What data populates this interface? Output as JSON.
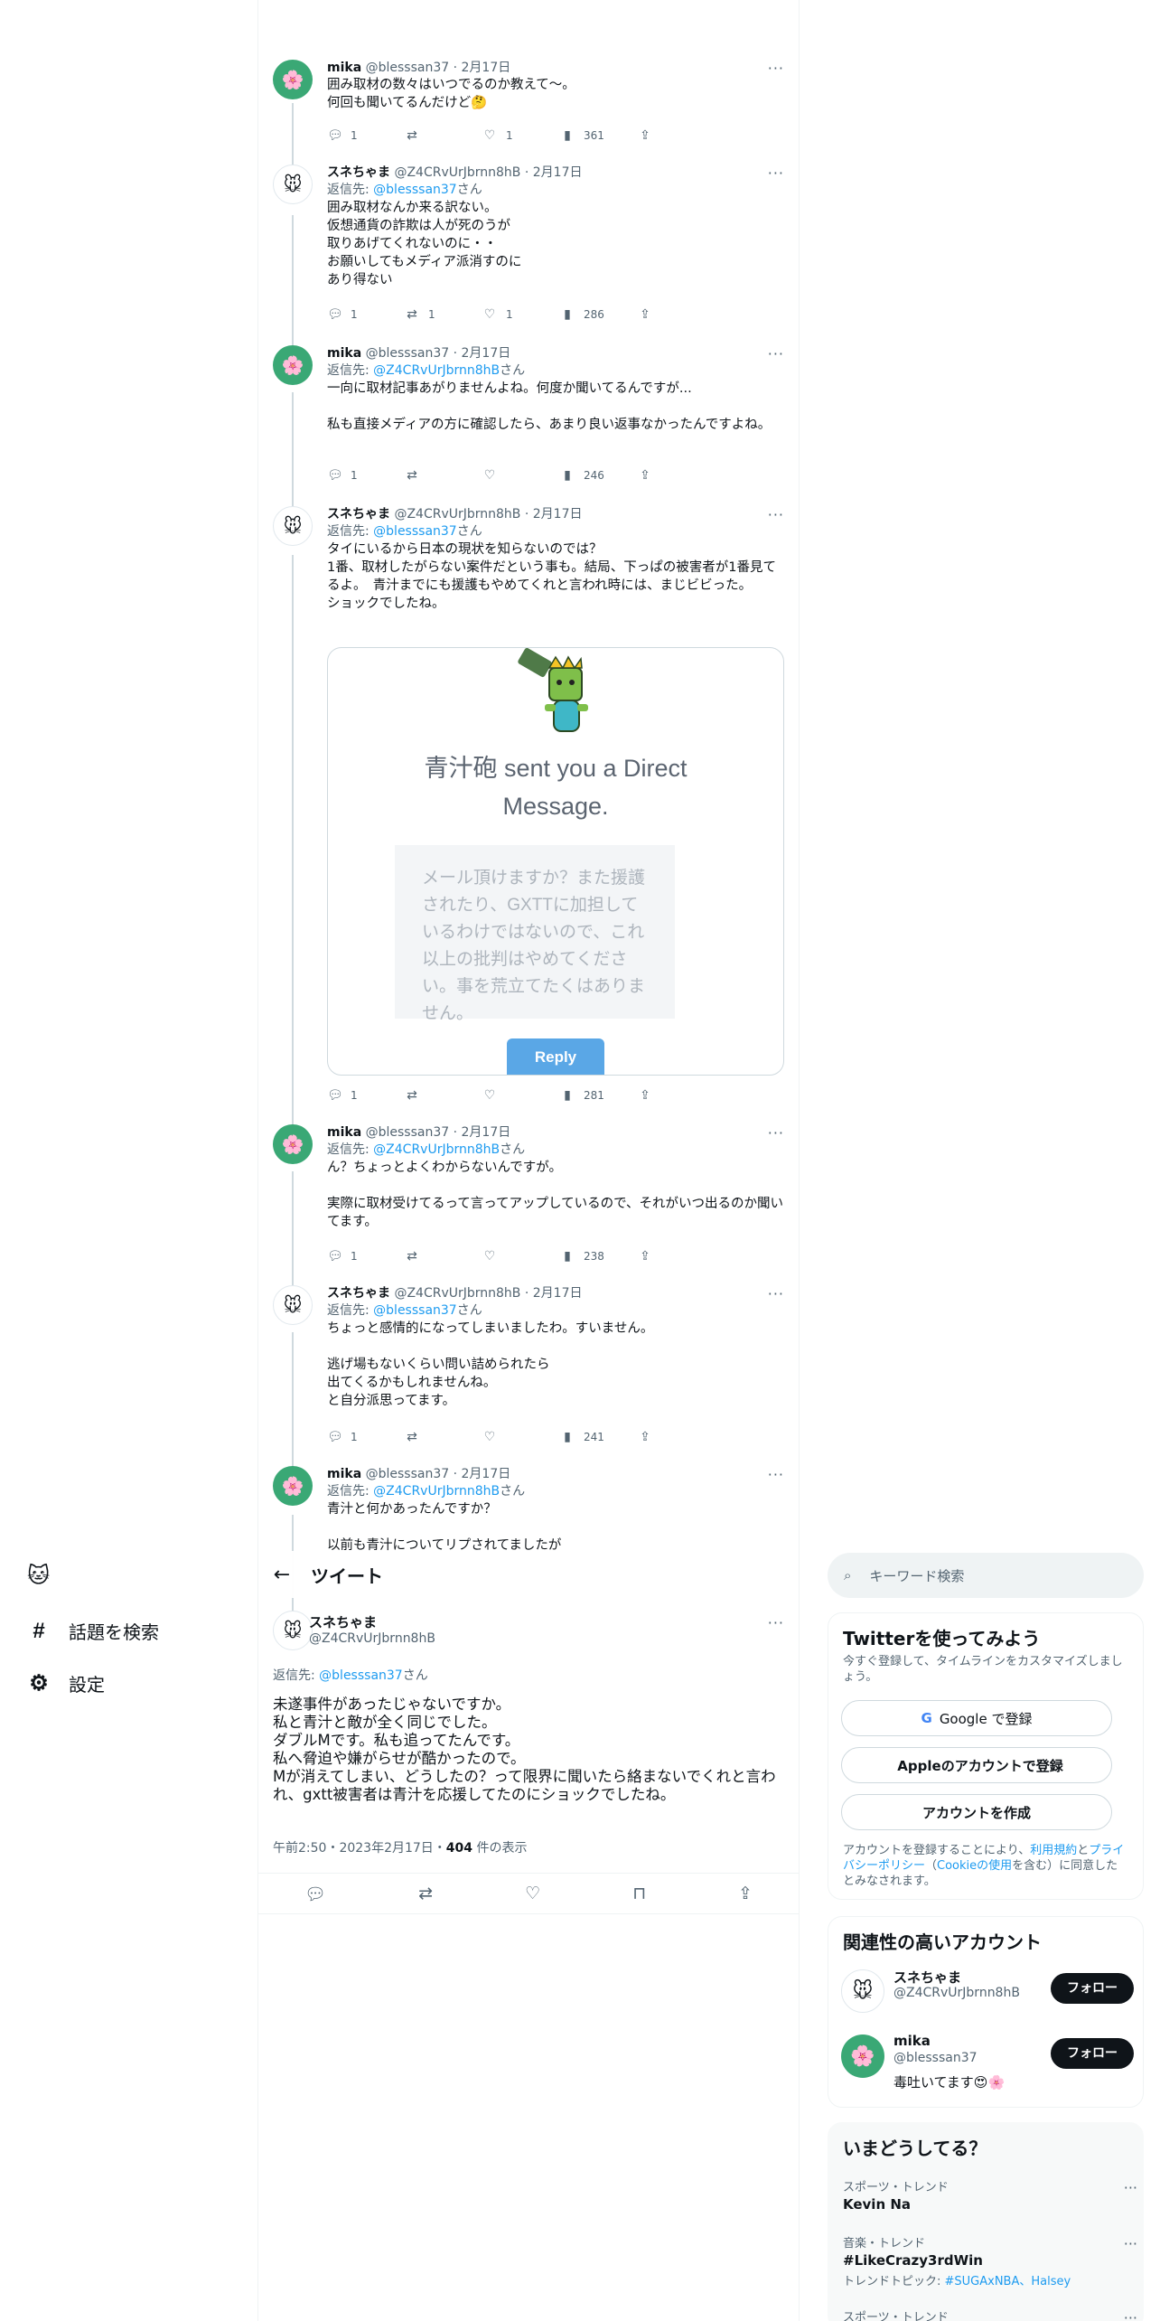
{
  "nav": {
    "logo_icon": "🐱",
    "items": [
      {
        "label": "話題を検索",
        "icon": "#"
      },
      {
        "label": "設定",
        "icon": "⚙"
      }
    ]
  },
  "tweets": [
    {
      "name": "mika",
      "handle": "@blesssan37",
      "date": "2月17日",
      "avatar": "mika",
      "reply_to": null,
      "text": "囲み取材の数々はいつでるのか教えて〜。\n何回も聞いてるんだけど🤔",
      "replies": "1",
      "retweets": "",
      "likes": "1",
      "views": "361"
    },
    {
      "name": "スネちゃま",
      "handle": "@Z4CRvUrJbrnn8hB",
      "date": "2月17日",
      "avatar": "sune",
      "reply_to": "@blesssan37",
      "text": "囲み取材なんか来る訳ない。\n仮想通貨の詐欺は人が死のうが\n取りあげてくれないのに・・\nお願いしてもメディア派消すのに\nあり得ない",
      "replies": "1",
      "retweets": "1",
      "likes": "1",
      "views": "286"
    },
    {
      "name": "mika",
      "handle": "@blesssan37",
      "date": "2月17日",
      "avatar": "mika",
      "reply_to": "@Z4CRvUrJbrnn8hB",
      "text": "一向に取材記事あがりませんよね。何度か聞いてるんですが...\n\n私も直接メディアの方に確認したら、あまり良い返事なかったんですよね。",
      "replies": "1",
      "retweets": "",
      "likes": "",
      "views": "246"
    },
    {
      "name": "スネちゃま",
      "handle": "@Z4CRvUrJbrnn8hB",
      "date": "2月17日",
      "avatar": "sune",
      "reply_to": "@blesssan37",
      "text": "タイにいるから日本の現状を知らないのでは？\n1番、取材したがらない案件だという事も。結局、下っぱの被害者が1番見てるよ。　青汁までにも援護もやめてくれと言われ時には、まじビビった。\nショックでしたね。",
      "replies": "1",
      "retweets": "",
      "likes": "",
      "views": "281"
    },
    {
      "name": "mika",
      "handle": "@blesssan37",
      "date": "2月17日",
      "avatar": "mika",
      "reply_to": "@Z4CRvUrJbrnn8hB",
      "text": "ん？ちょっとよくわからないんですが。\n\n実際に取材受けてるって言ってアップしているので、それがいつ出るのか聞いてます。",
      "replies": "1",
      "retweets": "",
      "likes": "",
      "views": "238"
    },
    {
      "name": "スネちゃま",
      "handle": "@Z4CRvUrJbrnn8hB",
      "date": "2月17日",
      "avatar": "sune",
      "reply_to": "@blesssan37",
      "text": "ちょっと感情的になってしまいましたわ。すいません。\n\n逃げ場もないくらい問い詰められたら\n出てくるかもしれませんね。\nと自分派思ってます。",
      "replies": "1",
      "retweets": "",
      "likes": "",
      "views": "241"
    },
    {
      "name": "mika",
      "handle": "@blesssan37",
      "date": "2月17日",
      "avatar": "mika",
      "reply_to": "@Z4CRvUrJbrnn8hB",
      "text": "青汁と何かあったんですか？\n\n以前も青汁についてリプされてましたが",
      "replies": "",
      "retweets": "",
      "likes": "",
      "views": ""
    }
  ],
  "dm_card": {
    "title": "青汁砲 sent you a Direct Message.",
    "message": "メール頂けますか？また援護されたり、GXTTに加担しているわけではないので、これ以上の批判はやめてください。事を荒立てたくはありません。",
    "button": "Reply"
  },
  "header": {
    "title": "ツイート",
    "back_icon": "←"
  },
  "focused": {
    "name": "スネちゃま",
    "handle": "@Z4CRvUrJbrnn8hB",
    "reply_prefix": "返信先: ",
    "reply_to": "@blesssan37",
    "reply_suffix": "さん",
    "text": "未遂事件があったじゃないですか。\n私と青汁と敵が全く同じでした。\nダブルMです。私も追ってたんです。\n私へ脅迫や嫌がらせが酷かったので。\nMが消えてしまい、どうしたの？って限界に聞いたら絡まないでくれと言わ\nれ、gxtt被害者は青汁を応援してたのにショックでしたね。",
    "time": "午前2:50・2023年2月17日・",
    "views": "404",
    "views_suffix": " 件の表示"
  },
  "labels": {
    "reply_prefix": "返信先: ",
    "reply_suffix": "さん",
    "more": "···"
  },
  "search": {
    "placeholder": "キーワード検索"
  },
  "signup": {
    "title": "Twitterを使ってみよう",
    "note": "今すぐ登録して、タイムラインをカスタマイズしましょう。",
    "google": "Google で登録",
    "apple": "Appleのアカウントで登録",
    "create": "アカウントを作成",
    "legal_1": "アカウントを登録することにより、",
    "legal_terms": "利用規約",
    "legal_2": "と",
    "legal_privacy": "プライバシーポリシー",
    "legal_3": "（",
    "legal_cookie": "Cookieの使用",
    "legal_4": "を含む）に同意したとみなされます。"
  },
  "related": {
    "title": "関連性の高いアカウント",
    "accounts": [
      {
        "name": "スネちゃま",
        "handle": "@Z4CRvUrJbrnn8hB",
        "bio": "",
        "follow": "フォロー"
      },
      {
        "name": "mika",
        "handle": "@blesssan37",
        "bio": "毒吐いてます😍🌸",
        "follow": "フォロー"
      }
    ]
  },
  "trends": {
    "title": "いまどうしてる？",
    "items": [
      {
        "category": "スポーツ・トレンド",
        "name": "Kevin Na",
        "sub_prefix": "",
        "sub_links": ""
      },
      {
        "category": "音楽・トレンド",
        "name": "#LikeCrazy3rdWin",
        "sub_prefix": "トレンドトピック: ",
        "sub_links": "#SUGAxNBA、Halsey"
      },
      {
        "category": "スポーツ・トレンド",
        "name": "",
        "sub_prefix": "",
        "sub_links": ""
      }
    ]
  },
  "colors": {
    "accent": "#1d9bf0",
    "text": "#0f1419",
    "muted": "#536471",
    "mika_avatar": "#3aa875"
  }
}
